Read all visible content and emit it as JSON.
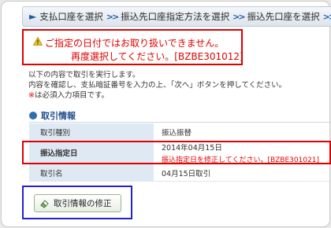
{
  "breadcrumb": {
    "items": [
      "支払口座を選択",
      "振込先口座指定方法を選択",
      "振込先口座を選択",
      "支"
    ]
  },
  "error_banner": {
    "line1": "ご指定の日付ではお取り扱いできません。",
    "line2": "再度選択してください。[BZBE301012]"
  },
  "intro": {
    "line1": "以下の内容で取引を実行します。",
    "line2": "内容を確認し、支払暗証番号を入力の上、「次へ」ボタンを押してください。",
    "line3_mark": "※",
    "line3_text": "は必須入力項目です。"
  },
  "section": {
    "title": "取引情報",
    "rows": [
      {
        "label": "取引種別",
        "value": "振込振替",
        "error": ""
      },
      {
        "label": "振込指定日",
        "value": "2014年04月15日",
        "error": "振込指定日を修正してください。[BZBE301021]"
      },
      {
        "label": "取引名",
        "value": "04月15日取引",
        "error": ""
      }
    ]
  },
  "edit_button": {
    "label": "取引情報の修正"
  },
  "colors": {
    "error": "#e00000",
    "accent": "#1f4f8f",
    "label_bg": "#dfe9f3",
    "highlight_blue": "#2222cc"
  },
  "icons": {
    "warning": "warning-icon",
    "section": "circle-bullet-icon",
    "edit": "eraser-icon"
  }
}
